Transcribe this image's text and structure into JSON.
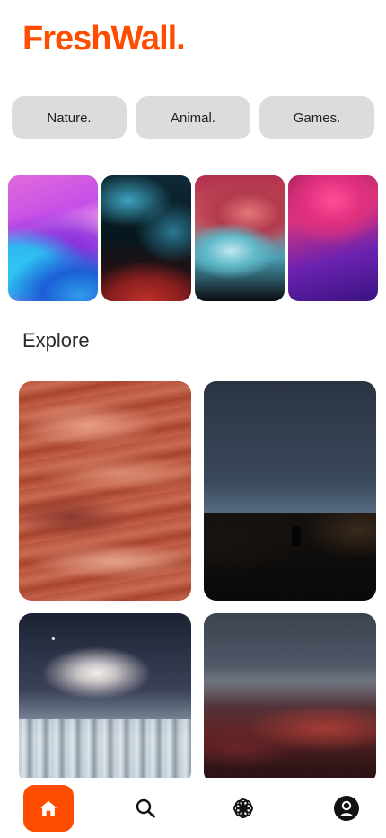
{
  "app": {
    "logo": "FreshWall."
  },
  "categories": [
    {
      "label": "Nature."
    },
    {
      "label": "Animal."
    },
    {
      "label": "Games."
    }
  ],
  "featured": [
    {
      "name": "purple-wave-wallpaper"
    },
    {
      "name": "teal-red-smoke-wallpaper"
    },
    {
      "name": "pink-teal-fluid-wallpaper"
    },
    {
      "name": "purple-pink-space-wallpaper"
    }
  ],
  "explore": {
    "title": "Explore",
    "items": [
      {
        "name": "red-swirl-wallpaper"
      },
      {
        "name": "night-sky-silhouette-wallpaper"
      },
      {
        "name": "galaxy-snow-forest-wallpaper"
      },
      {
        "name": "red-mountains-wallpaper"
      }
    ]
  },
  "nav": {
    "items": [
      {
        "icon": "home-icon",
        "active": true
      },
      {
        "icon": "search-icon",
        "active": false
      },
      {
        "icon": "flower-icon",
        "active": false
      },
      {
        "icon": "profile-icon",
        "active": false
      }
    ]
  },
  "colors": {
    "accent": "#ff4d00",
    "chip": "#dcdcdc"
  }
}
